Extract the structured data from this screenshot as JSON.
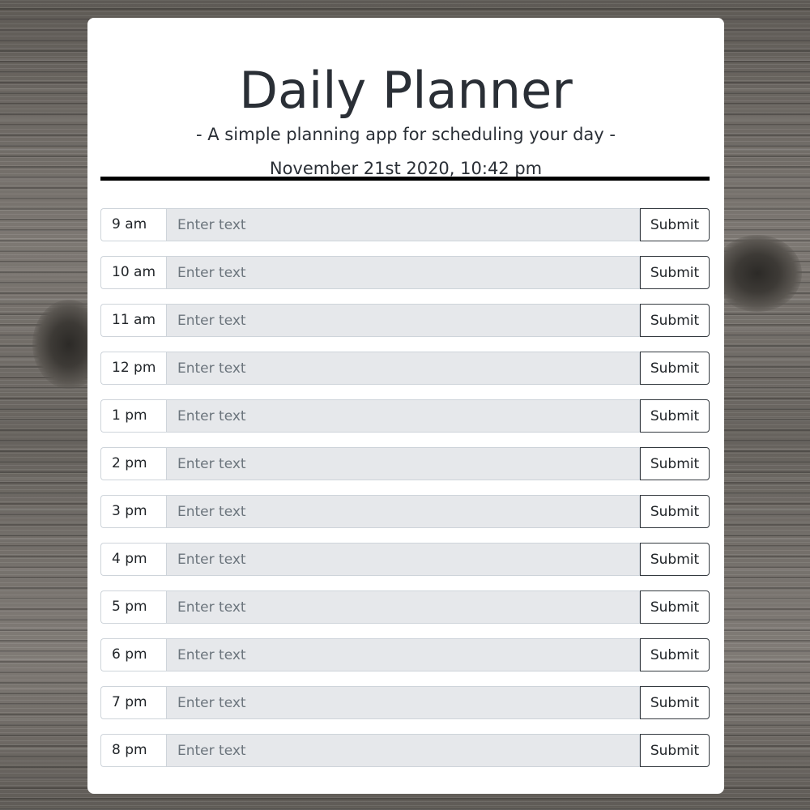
{
  "header": {
    "title": "Daily Planner",
    "subtitle": "- A simple planning app for scheduling your day -",
    "datetime": "November 21st 2020, 10:42 pm"
  },
  "colors": {
    "input_background": "#e6e8eb",
    "divider": "#000000",
    "text": "#2a2f36"
  },
  "rows": [
    {
      "hour": "9 am",
      "placeholder": "Enter text",
      "value": "",
      "button": "Submit"
    },
    {
      "hour": "10 am",
      "placeholder": "Enter text",
      "value": "",
      "button": "Submit"
    },
    {
      "hour": "11 am",
      "placeholder": "Enter text",
      "value": "",
      "button": "Submit"
    },
    {
      "hour": "12 pm",
      "placeholder": "Enter text",
      "value": "",
      "button": "Submit"
    },
    {
      "hour": "1 pm",
      "placeholder": "Enter text",
      "value": "",
      "button": "Submit"
    },
    {
      "hour": "2 pm",
      "placeholder": "Enter text",
      "value": "",
      "button": "Submit"
    },
    {
      "hour": "3 pm",
      "placeholder": "Enter text",
      "value": "",
      "button": "Submit"
    },
    {
      "hour": "4 pm",
      "placeholder": "Enter text",
      "value": "",
      "button": "Submit"
    },
    {
      "hour": "5 pm",
      "placeholder": "Enter text",
      "value": "",
      "button": "Submit"
    },
    {
      "hour": "6 pm",
      "placeholder": "Enter text",
      "value": "",
      "button": "Submit"
    },
    {
      "hour": "7 pm",
      "placeholder": "Enter text",
      "value": "",
      "button": "Submit"
    },
    {
      "hour": "8 pm",
      "placeholder": "Enter text",
      "value": "",
      "button": "Submit"
    }
  ]
}
